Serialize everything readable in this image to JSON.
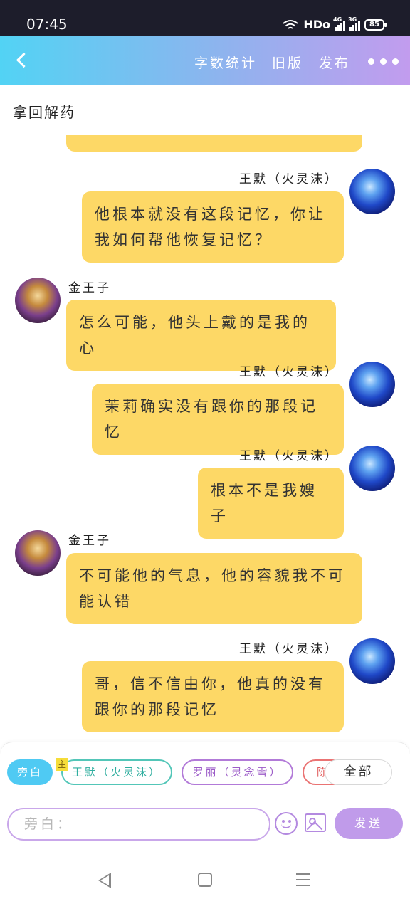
{
  "status_bar": {
    "time": "07:45",
    "network": "HDo",
    "sim1": "4G",
    "sim2": "3G",
    "battery": "85"
  },
  "header": {
    "links": [
      "字数统计",
      "旧版",
      "发布"
    ],
    "accent_gradient": [
      "#52d3f4",
      "#c29cee"
    ]
  },
  "title": "拿回解药",
  "chat": {
    "bubble_color": "#fdd866",
    "messages": [
      {
        "side": "right",
        "speaker": "",
        "text": ""
      },
      {
        "side": "right",
        "speaker": "王默（火灵沫）",
        "avatar": "blue-hair-girl-avatar",
        "lines": [
          "他根本就没有这段记忆，你让",
          "我如何帮他恢复记忆？"
        ]
      },
      {
        "side": "left",
        "speaker": "金王子",
        "avatar": "golden-prince-avatar",
        "lines": [
          "怎么可能，他头上戴的是我的心"
        ]
      },
      {
        "side": "right",
        "speaker": "王默（火灵沫）",
        "avatar": "blue-hair-girl-avatar",
        "lines": [
          "茉莉确实没有跟你的那段记忆"
        ]
      },
      {
        "side": "right",
        "speaker": "王默（火灵沫）",
        "avatar": "blue-hair-girl-avatar",
        "lines": [
          "根本不是我嫂子"
        ]
      },
      {
        "side": "left",
        "speaker": "金王子",
        "avatar": "golden-prince-avatar",
        "lines": [
          "不可能他的气息，他的容貌我不可",
          "能认错"
        ]
      },
      {
        "side": "right",
        "speaker": "王默（火灵沫）",
        "avatar": "blue-hair-girl-avatar",
        "lines": [
          "哥，信不信由你，他真的没有",
          "跟你的那段记忆"
        ]
      }
    ]
  },
  "composer": {
    "roles": {
      "narration": "旁白",
      "main_badge": "主",
      "main": "王默（火灵沫）",
      "luoli": "罗丽（灵念雪）",
      "chen": "陈",
      "all": "全部"
    },
    "input_placeholder": "旁白：",
    "send_label": "发送",
    "role_colors": {
      "narration": "#4fcaf3",
      "main": "#53c6b8",
      "luoli": "#b27ad8",
      "chen": "#ea7373",
      "send": "#c09bea"
    }
  }
}
